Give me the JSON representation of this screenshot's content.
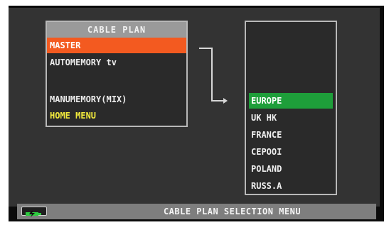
{
  "cable_plan": {
    "title": "CABLE PLAN",
    "items": [
      {
        "label": "MASTER",
        "state": "active"
      },
      {
        "label": "AUTOMEMORY tv",
        "state": "normal"
      },
      {
        "label": "MANUMEMORY(MIX)",
        "state": "normal"
      },
      {
        "label": "HOME MENU",
        "state": "home"
      }
    ]
  },
  "regions": {
    "items": [
      {
        "label": "EUROPE",
        "state": "active"
      },
      {
        "label": "UK HK",
        "state": "normal"
      },
      {
        "label": "FRANCE",
        "state": "normal"
      },
      {
        "label": "CEPOOI",
        "state": "normal"
      },
      {
        "label": "POLAND",
        "state": "normal"
      },
      {
        "label": "RUSS.A",
        "state": "normal"
      }
    ]
  },
  "statusbar": {
    "title": "CABLE PLAN SELECTION MENU",
    "battery_icon": "battery-charging-icon"
  },
  "colors": {
    "active_orange": "#f35a20",
    "active_green": "#1e9e3a",
    "home_yellow": "#f2ea3c",
    "battery_green": "#2ecc40"
  }
}
